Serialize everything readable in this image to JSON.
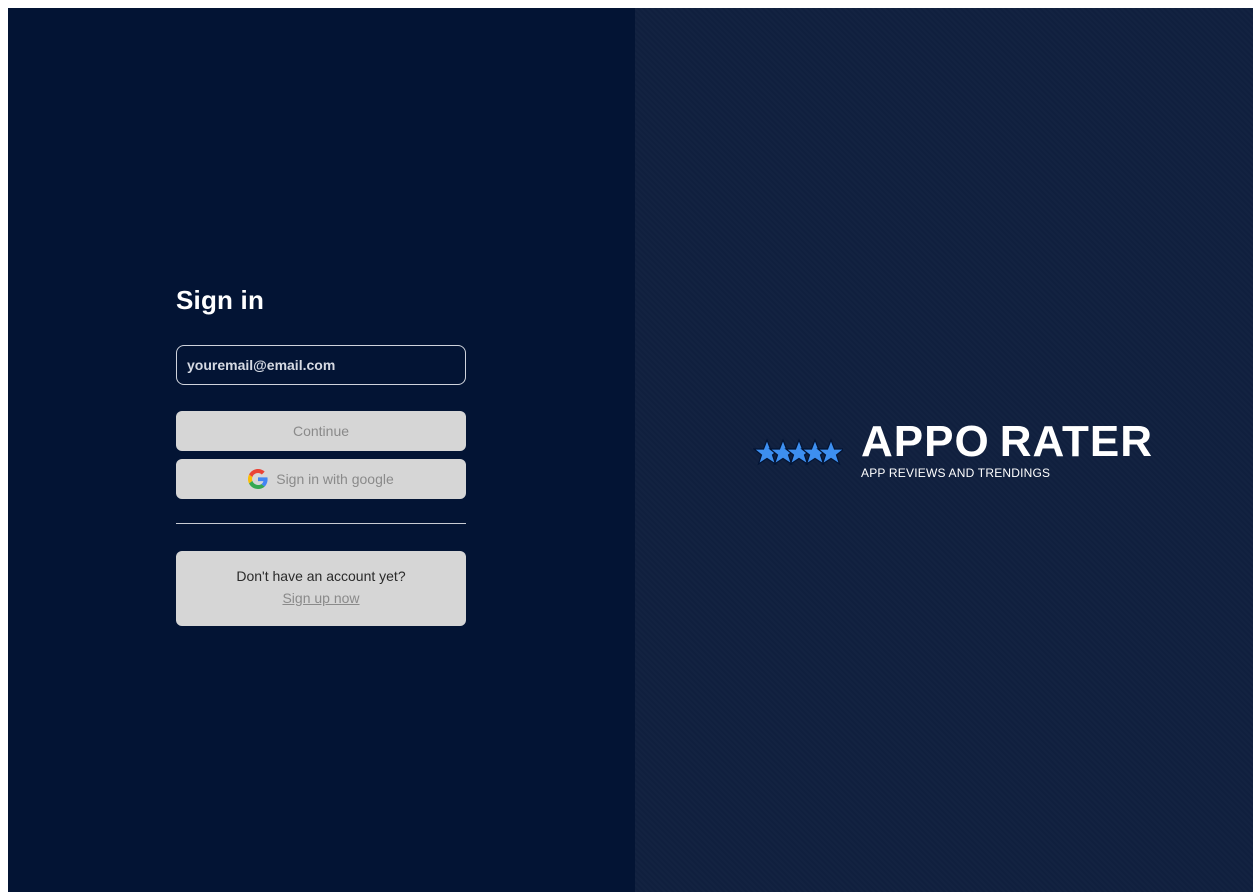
{
  "signin": {
    "title": "Sign in",
    "email_placeholder": "youremail@email.com",
    "continue_label": "Continue",
    "google_label": "Sign in with google",
    "no_account_text": "Don't have an account yet?",
    "signup_label": "Sign up now"
  },
  "brand": {
    "name_part1": "APPO",
    "name_part2": "RATER",
    "tagline": "APP REVIEWS AND TRENDINGS",
    "star_icon": "stars-icon",
    "star_color": "#3d8ff0"
  },
  "colors": {
    "left_bg": "#031434",
    "right_bg": "#10203f",
    "button_bg": "#d6d6d6"
  }
}
